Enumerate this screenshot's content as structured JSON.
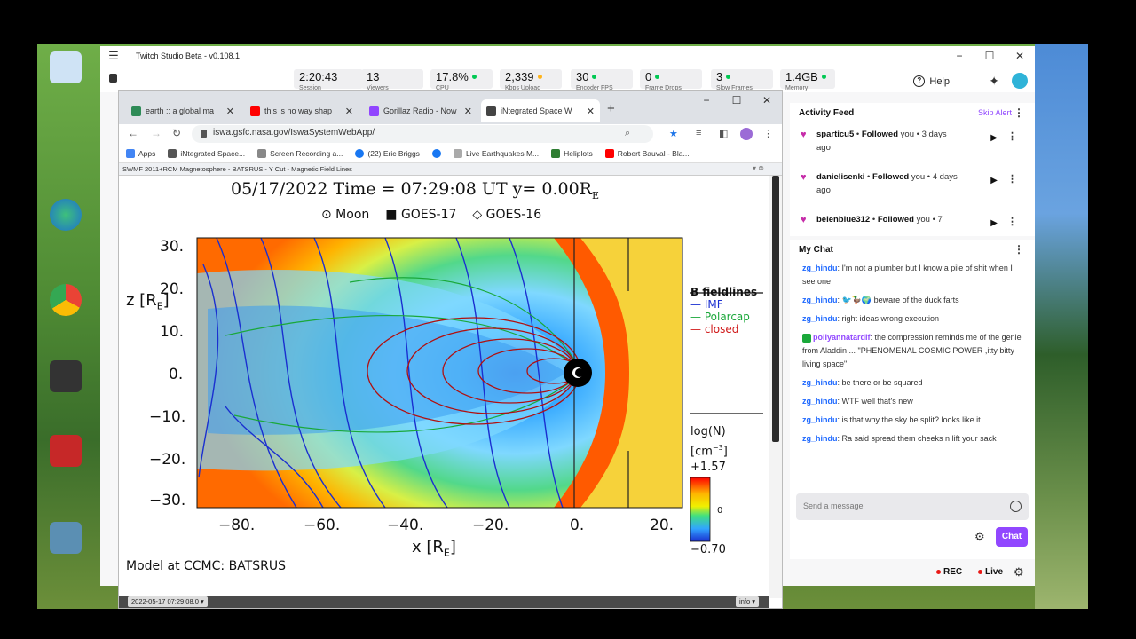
{
  "twitch": {
    "title": "Twitch Studio Beta - v0.108.1",
    "stats": [
      {
        "value": "2:20:43",
        "key": "Session",
        "dot": ""
      },
      {
        "value": "13",
        "key": "Viewers",
        "dot": ""
      },
      {
        "value": "17.8%",
        "key": "CPU",
        "dot": "#00c853"
      },
      {
        "value": "2,339",
        "key": "Kbps Upload",
        "dot": "#ffb31a"
      },
      {
        "value": "30",
        "key": "Encoder FPS",
        "dot": "#00c853"
      },
      {
        "value": "0",
        "key": "Frame Drops",
        "dot": "#00c853"
      },
      {
        "value": "3",
        "key": "Slow Frames",
        "dot": "#00c853"
      },
      {
        "value": "1.4GB",
        "key": "Memory",
        "dot": "#00c853"
      }
    ],
    "help": "Help",
    "activity_feed": {
      "title": "Activity Feed",
      "skip": "Skip Alert",
      "items": [
        {
          "user": "sparticu5",
          "action": "Followed",
          "rest": "you • 3 days",
          "rest2": "ago"
        },
        {
          "user": "danielisenki",
          "action": "Followed",
          "rest": "you • 4 days",
          "rest2": "ago"
        },
        {
          "user": "belenblue312",
          "action": "Followed",
          "rest": "you • 7",
          "rest2": ""
        }
      ]
    },
    "chat": {
      "title": "My Chat",
      "messages": [
        {
          "user": "zg_hindu",
          "text": ": I'm not a plumber but I know a pile of shit when I see one"
        },
        {
          "user": "zg_hindu",
          "text": ": 🐦🦆🌍 beware of the duck farts"
        },
        {
          "user": "zg_hindu",
          "text": ": right ideas wrong execution"
        },
        {
          "user": "pollyannatardif",
          "text": ": the compression reminds me of the genie from Aladdin ... \"PHENOMENAL COSMIC POWER ,itty bitty living space\""
        },
        {
          "user": "zg_hindu",
          "text": ": be there or be squared"
        },
        {
          "user": "zg_hindu",
          "text": ": WTF well that's new"
        },
        {
          "user": "zg_hindu",
          "text": ": is that why the sky be split? looks like it"
        },
        {
          "user": "zg_hindu",
          "text": ": Ra said spread them cheeks n lift your sack"
        }
      ],
      "placeholder": "Send a message",
      "button": "Chat"
    },
    "rec": "REC",
    "live": "Live"
  },
  "browser": {
    "tabs": [
      {
        "label": "earth :: a global ma",
        "color": "#2e8b57"
      },
      {
        "label": "this is no way shap",
        "color": "#ff0000"
      },
      {
        "label": "Gorillaz Radio - Now",
        "color": "#9146ff"
      },
      {
        "label": "iNtegrated Space W",
        "color": "#444444"
      }
    ],
    "url": "iswa.gsfc.nasa.gov/IswaSystemWebApp/",
    "bookmarks": [
      {
        "label": "Apps",
        "color": "#4285f4"
      },
      {
        "label": "iNtegrated Space...",
        "color": "#555555"
      },
      {
        "label": "Screen Recording a...",
        "color": "#888888"
      },
      {
        "label": "(22) Eric Briggs",
        "color": "#1877f2"
      },
      {
        "label": "",
        "color": "#1877f2"
      },
      {
        "label": "Live Earthquakes M...",
        "color": "#aaaaaa"
      },
      {
        "label": "Heliplots",
        "color": "#2e7d32"
      },
      {
        "label": "Robert Bauval - Bla...",
        "color": "#ff0000"
      }
    ],
    "infobar": "SWMF 2011+RCM Magnetosphere - BATSRUS - Y Cut - Magnetic Field Lines",
    "status_date": "2022-05-17 07:29:08.0 ▾",
    "status_info": "info ▾"
  },
  "plot": {
    "title": "05/17/2022 Time = 07:29:08 UT y= 0.00R",
    "title_sub": "E",
    "legend": [
      "⊙ Moon",
      "■ GOES-17",
      "◇ GOES-16"
    ],
    "yticks": [
      "30.",
      "20.",
      "10.",
      "0.",
      "−10.",
      "−20.",
      "−30."
    ],
    "xticks": [
      "−80.",
      "−60.",
      "−40.",
      "−20.",
      "0.",
      "20."
    ],
    "xlabel": "x [R",
    "zlabel": "z [R",
    "label_sub": "E",
    "label_close": "]",
    "fieldlines_title": "B fieldlines",
    "fieldlines": [
      {
        "label": "IMF",
        "color": "#1a2fd0"
      },
      {
        "label": "Polarcap",
        "color": "#1aa83a"
      },
      {
        "label": "closed",
        "color": "#d01a1a"
      }
    ],
    "cbar_title": "log(N)",
    "cbar_unit": "[cm",
    "cbar_unit_exp": "−3",
    "cbar_max": "+1.57",
    "cbar_mid": "0",
    "cbar_min": "−0.70",
    "model": "Model at CCMC: BATSRUS"
  }
}
